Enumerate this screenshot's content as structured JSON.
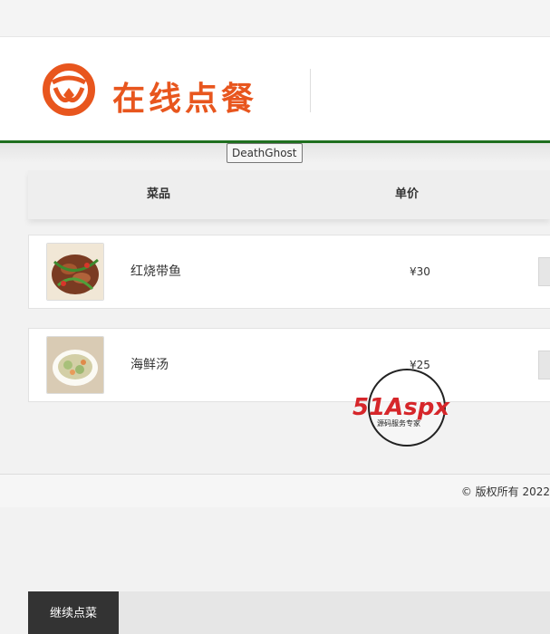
{
  "brand": {
    "title": "在线点餐",
    "accent_color": "#e8561e"
  },
  "header": {
    "rule_color": "#1f6f1f"
  },
  "tooltip": {
    "text": "DeathGhost"
  },
  "table": {
    "columns": [
      "菜品",
      "单价"
    ],
    "rows": [
      {
        "name": "红烧带鱼",
        "price": "¥30"
      },
      {
        "name": "海鲜汤",
        "price": "¥25"
      }
    ]
  },
  "actions": {
    "continue_label": "继续点菜"
  },
  "footer": {
    "copyright": "© 版权所有 2022"
  },
  "watermark": {
    "brand": "51Aspx",
    "tagline": "源码服务专家"
  }
}
